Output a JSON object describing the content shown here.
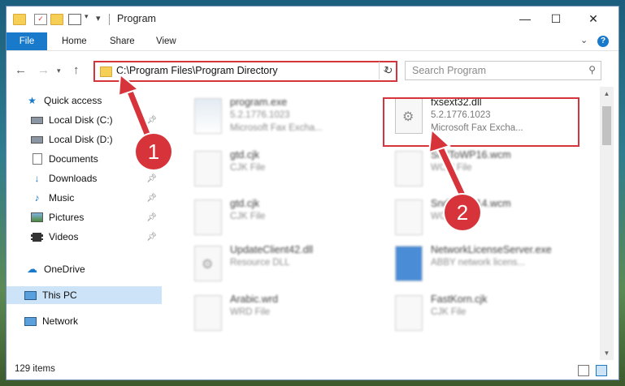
{
  "window": {
    "title": "Program"
  },
  "ribbon": {
    "tabs": [
      "File",
      "Home",
      "Share",
      "View"
    ]
  },
  "address": {
    "path": "C:\\Program Files\\Program Directory"
  },
  "search": {
    "placeholder": "Search Program"
  },
  "nav": {
    "items": [
      {
        "label": "Quick access",
        "icon": "star-icon",
        "pinned": false
      },
      {
        "label": "Local Disk (C:)",
        "icon": "drive-icon",
        "pinned": true
      },
      {
        "label": "Local Disk (D:)",
        "icon": "drive-icon",
        "pinned": false
      },
      {
        "label": "Documents",
        "icon": "documents-icon",
        "pinned": true
      },
      {
        "label": "Downloads",
        "icon": "download-icon",
        "pinned": true
      },
      {
        "label": "Music",
        "icon": "music-icon",
        "pinned": true
      },
      {
        "label": "Pictures",
        "icon": "pictures-icon",
        "pinned": true
      },
      {
        "label": "Videos",
        "icon": "videos-icon",
        "pinned": true
      },
      {
        "label": "OneDrive",
        "icon": "cloud-icon",
        "pinned": false
      },
      {
        "label": "This PC",
        "icon": "computer-icon",
        "pinned": false,
        "selected": true
      },
      {
        "label": "Network",
        "icon": "network-icon",
        "pinned": false
      }
    ]
  },
  "files": [
    {
      "name": "program.exe",
      "line1": "5.2.1776.1023",
      "line2": "Microsoft Fax Excha...",
      "type": "exe"
    },
    {
      "name": "fxsext32.dll",
      "line1": "5.2.1776.1023",
      "line2": "Microsoft Fax Excha...",
      "type": "dll",
      "highlighted": true
    },
    {
      "name": "gtd.cjk",
      "line1": "CJK File",
      "line2": "",
      "type": "file"
    },
    {
      "name": "SndToWP16.wcm",
      "line1": "WCM File",
      "line2": "",
      "type": "file"
    },
    {
      "name": "gtd.cjk",
      "line1": "CJK File",
      "line2": "",
      "type": "file"
    },
    {
      "name": "SndToWP14.wcm",
      "line1": "WCM File",
      "line2": "",
      "type": "file"
    },
    {
      "name": "UpdateClient42.dll",
      "line1": "Resource DLL",
      "line2": "",
      "type": "dll"
    },
    {
      "name": "NetworkLicenseServer.exe",
      "line1": "ABBY network licens...",
      "line2": "",
      "type": "exe"
    },
    {
      "name": "Arabic.wrd",
      "line1": "WRD File",
      "line2": "",
      "type": "file"
    },
    {
      "name": "FastKorn.cjk",
      "line1": "CJK File",
      "line2": "",
      "type": "file"
    }
  ],
  "status": {
    "item_count": "129 items"
  },
  "annotations": [
    "1",
    "2"
  ],
  "colors": {
    "accent": "#1979ca",
    "highlight": "#d6333a",
    "selection": "#cde3f7"
  }
}
